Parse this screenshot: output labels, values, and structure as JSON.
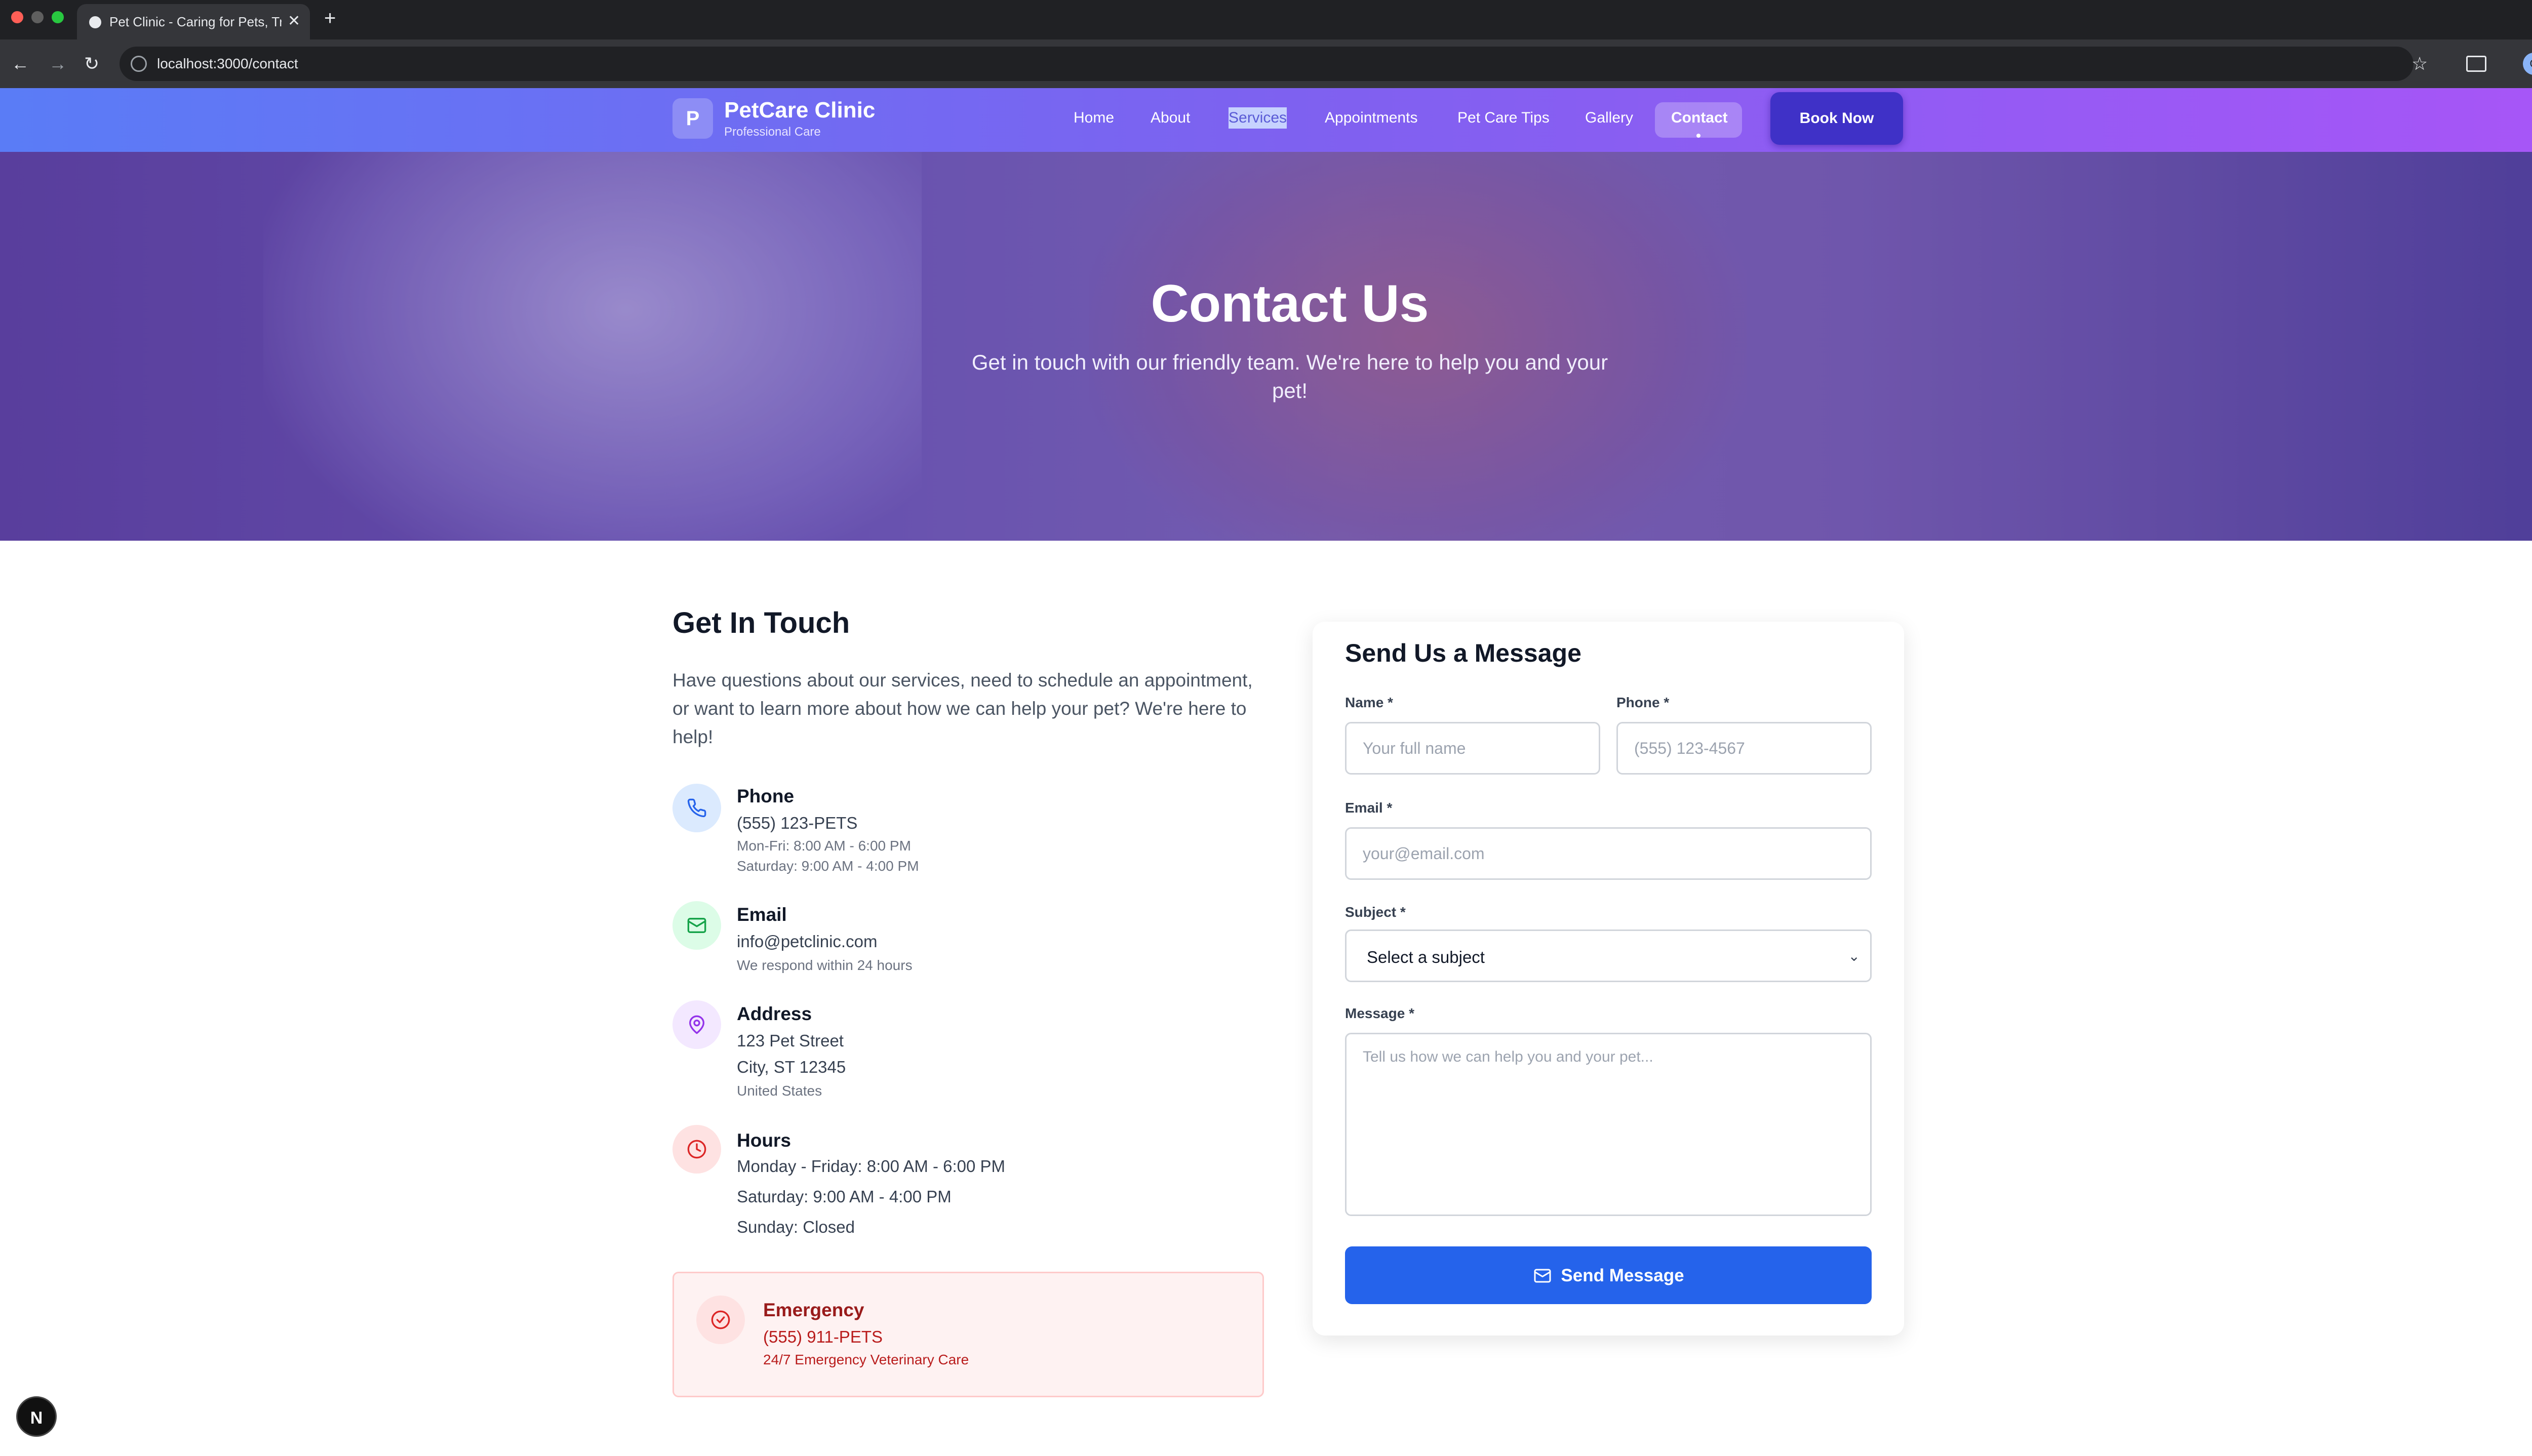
{
  "browser": {
    "tab_title": "Pet Clinic - Caring for Pets, Tr",
    "tab_close": "✕",
    "new_tab": "+",
    "url": "localhost:3000/contact",
    "back": "←",
    "forward": "→",
    "reload": "↻",
    "bookmark": "☆",
    "profile_initial": "O",
    "menu": "⋮"
  },
  "header": {
    "logo_letter": "P",
    "brand_name": "PetCare Clinic",
    "brand_tagline": "Professional Care",
    "nav": [
      "Home",
      "About",
      "Services",
      "Appointments",
      "Pet Care Tips",
      "Gallery",
      "Contact"
    ],
    "active_nav": "Contact",
    "book_button": "Book Now"
  },
  "hero": {
    "title": "Contact Us",
    "subtitle": "Get in touch with our friendly team. We're here to help you and your pet!"
  },
  "contact_info": {
    "heading": "Get In Touch",
    "intro": "Have questions about our services, need to schedule an appointment, or want to learn more about how we can help your pet? We're here to help!",
    "phone": {
      "title": "Phone",
      "value": "(555) 123-PETS",
      "line1": "Mon-Fri: 8:00 AM - 6:00 PM",
      "line2": "Saturday: 9:00 AM - 4:00 PM"
    },
    "email": {
      "title": "Email",
      "value": "info@petclinic.com",
      "note": "We respond within 24 hours"
    },
    "address": {
      "title": "Address",
      "street": "123 Pet Street",
      "city": "City, ST 12345",
      "country": "United States"
    },
    "hours": {
      "title": "Hours",
      "weekdays": "Monday - Friday: 8:00 AM - 6:00 PM",
      "saturday": "Saturday: 9:00 AM - 4:00 PM",
      "sunday": "Sunday: Closed"
    },
    "emergency": {
      "title": "Emergency",
      "phone": "(555) 911-PETS",
      "note": "24/7 Emergency Veterinary Care"
    }
  },
  "form": {
    "title": "Send Us a Message",
    "name_label": "Name *",
    "name_placeholder": "Your full name",
    "phone_label": "Phone *",
    "phone_placeholder": "(555) 123-4567",
    "email_label": "Email *",
    "email_placeholder": "your@email.com",
    "subject_label": "Subject *",
    "subject_value": "Select a subject",
    "message_label": "Message *",
    "message_placeholder": "Tell us how we can help you and your pet...",
    "submit_label": "Send Message"
  },
  "dev_badge": "N",
  "colors": {
    "primary": "#2563eb",
    "header_start": "#5a7cf6",
    "header_end": "#a855f7",
    "book_button": "#3f31c7",
    "emergency_bg": "#fef2f2",
    "emergency_text": "#991b1b"
  }
}
